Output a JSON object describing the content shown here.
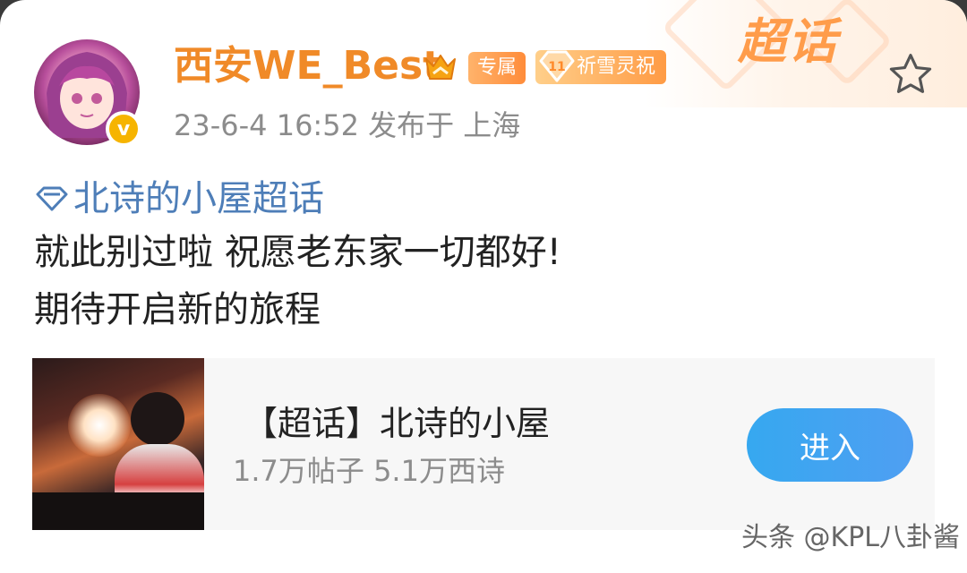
{
  "post": {
    "username": "西安WE_Best",
    "badge_exclusive": "专属",
    "badge_level": "11",
    "badge_name": "祈雪灵祝",
    "meta": "23-6-4 16:52   发布于 上海",
    "supertopic_label": "超话",
    "topic_tag": "北诗的小屋超话",
    "lines": [
      "就此别过啦 祝愿老东家一切都好!",
      "期待开启新的旅程"
    ]
  },
  "topic_card": {
    "title": "【超话】北诗的小屋",
    "stats": "1.7万帖子 5.1万西诗",
    "enter_label": "进入"
  },
  "watermark": "头条 @KPL八卦酱",
  "colors": {
    "username": "#f08a28",
    "topic_link": "#4e7eb8",
    "enter_button": "#4f9ff2",
    "badge": "#ff9b45"
  },
  "icons": {
    "favorite": "star-icon",
    "vip": "vip-crown-icon",
    "verified": "verified-icon",
    "topic": "diamond-icon"
  }
}
